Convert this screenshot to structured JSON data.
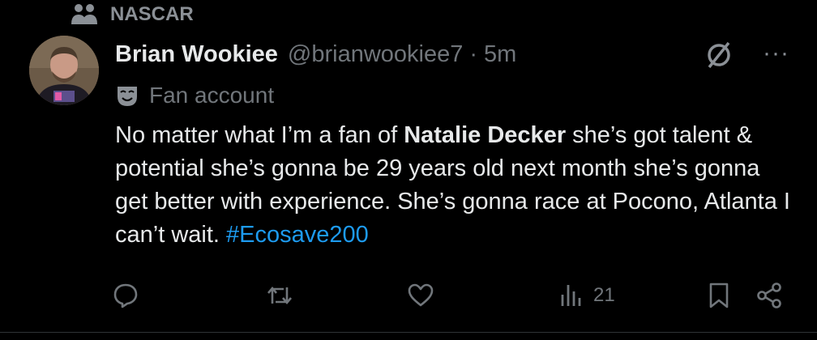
{
  "community": {
    "name": "NASCAR",
    "icon": "community-people-icon"
  },
  "post": {
    "author_name": "Brian Wookiee",
    "handle": "@brianwookiee7",
    "separator": "·",
    "time": "5m",
    "badge_label": "Fan account",
    "badge_icon": "theater-mask-icon",
    "text_part1": "No matter what I’m a fan of ",
    "text_bold": "Natalie Decker",
    "text_part2": " she’s got talent & potential she’s gonna be 29 years old next month she’s gonna get better with experience. She’s gonna race at Pocono, Atlanta I can’t wait. ",
    "hashtag": "#Ecosave200"
  },
  "actions": {
    "reply_icon": "reply-icon",
    "repost_icon": "repost-icon",
    "like_icon": "like-icon",
    "views_icon": "views-icon",
    "views_count": "21",
    "bookmark_icon": "bookmark-icon",
    "share_icon": "share-icon"
  },
  "top_icons": {
    "grok": "grok-icon",
    "more": "···"
  },
  "colors": {
    "background": "#000000",
    "text": "#e7e9ea",
    "muted": "#71767b",
    "accent": "#1d9bf0"
  }
}
